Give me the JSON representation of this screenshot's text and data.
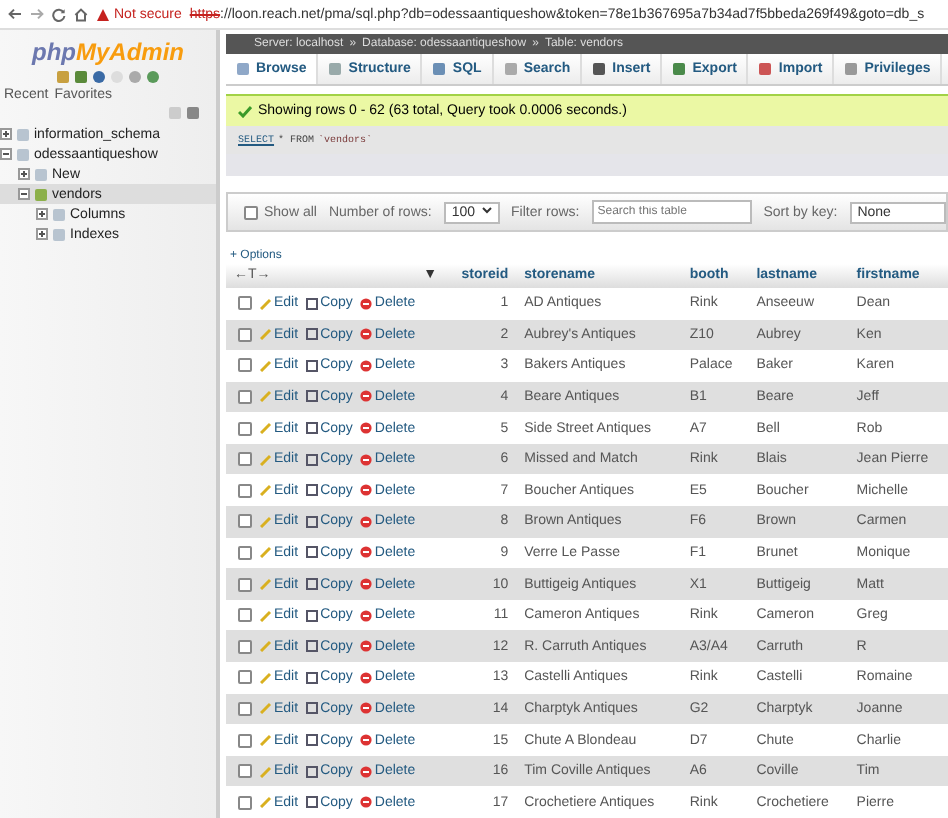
{
  "browser": {
    "security": "Not secure",
    "url_scheme": "https",
    "url_rest": "://loon.reach.net/pma/sql.php?db=odessaantiqueshow&token=78e1b367695a7b34ad7f5bbeda269f49&goto=db_s"
  },
  "sidebar": {
    "logo_left": "php",
    "logo_right": "MyAdmin",
    "links": [
      "Recent",
      "Favorites"
    ],
    "tree": [
      {
        "label": "information_schema",
        "expanded": false,
        "selected": false
      },
      {
        "label": "odessaantiqueshow",
        "expanded": true,
        "selected": false,
        "children": [
          {
            "label": "New",
            "expanded": false,
            "selected": false
          },
          {
            "label": "vendors",
            "expanded": true,
            "selected": true,
            "children": [
              {
                "label": "Columns",
                "expanded": false,
                "selected": false
              },
              {
                "label": "Indexes",
                "expanded": false,
                "selected": false
              }
            ]
          }
        ]
      }
    ]
  },
  "breadcrumb": [
    "Server: localhost",
    "»",
    "Database: odessaantiqueshow",
    "»",
    "Table: vendors"
  ],
  "tabs": [
    {
      "label": "Browse",
      "selected": true
    },
    {
      "label": "Structure",
      "selected": false
    },
    {
      "label": "SQL",
      "selected": false
    },
    {
      "label": "Search",
      "selected": false
    },
    {
      "label": "Insert",
      "selected": false
    },
    {
      "label": "Export",
      "selected": false
    },
    {
      "label": "Import",
      "selected": false
    },
    {
      "label": "Privileges",
      "selected": false
    }
  ],
  "message": "Showing rows 0 - 62 (63 total, Query took 0.0006 seconds.)",
  "query": {
    "keyword1": "SELECT",
    "rest": "* FROM",
    "table": "`vendors`"
  },
  "filter_bar": {
    "show_all": {
      "label": "Show all",
      "checked": false
    },
    "rows_label": "Number of rows:",
    "rows_value": "100",
    "filter_label": "Filter rows:",
    "filter_placeholder": "Search this table",
    "sort_label": "Sort by key:",
    "sort_value": "None"
  },
  "options": "+ Options",
  "table": {
    "resize_handle": "←T→",
    "sort_marker": "▼",
    "columns": [
      "storeid",
      "storename",
      "booth",
      "lastname",
      "firstname"
    ],
    "rows": [
      {
        "checked": false,
        "actions": [
          "Edit",
          "Copy",
          "Delete"
        ],
        "cells": [
          "1",
          "AD Antiques",
          "Rink",
          "Anseeuw",
          "Dean"
        ]
      },
      {
        "checked": false,
        "actions": [
          "Edit",
          "Copy",
          "Delete"
        ],
        "cells": [
          "2",
          "Aubrey's Antiques",
          "Z10",
          "Aubrey",
          "Ken"
        ]
      },
      {
        "checked": false,
        "actions": [
          "Edit",
          "Copy",
          "Delete"
        ],
        "cells": [
          "3",
          "Bakers Antiques",
          "Palace",
          "Baker",
          "Karen"
        ]
      },
      {
        "checked": false,
        "actions": [
          "Edit",
          "Copy",
          "Delete"
        ],
        "cells": [
          "4",
          "Beare  Antiques",
          "B1",
          "Beare",
          "Jeff"
        ]
      },
      {
        "checked": false,
        "actions": [
          "Edit",
          "Copy",
          "Delete"
        ],
        "cells": [
          "5",
          "Side Street Antiques",
          "A7",
          "Bell",
          "Rob"
        ]
      },
      {
        "checked": false,
        "actions": [
          "Edit",
          "Copy",
          "Delete"
        ],
        "cells": [
          "6",
          "Missed and Match",
          "Rink",
          "Blais",
          "Jean Pierre"
        ]
      },
      {
        "checked": false,
        "actions": [
          "Edit",
          "Copy",
          "Delete"
        ],
        "cells": [
          "7",
          "Boucher Antiques",
          "E5",
          "Boucher",
          "Michelle"
        ]
      },
      {
        "checked": false,
        "actions": [
          "Edit",
          "Copy",
          "Delete"
        ],
        "cells": [
          "8",
          "Brown Antiques",
          "F6",
          "Brown",
          "Carmen"
        ]
      },
      {
        "checked": false,
        "actions": [
          "Edit",
          "Copy",
          "Delete"
        ],
        "cells": [
          "9",
          "Verre Le Passe",
          "F1",
          "Brunet",
          "Monique"
        ]
      },
      {
        "checked": false,
        "actions": [
          "Edit",
          "Copy",
          "Delete"
        ],
        "cells": [
          "10",
          "Buttigeig Antiques",
          "X1",
          "Buttigeig",
          "Matt"
        ]
      },
      {
        "checked": false,
        "actions": [
          "Edit",
          "Copy",
          "Delete"
        ],
        "cells": [
          "11",
          "Cameron Antiques",
          "Rink",
          "Cameron",
          "Greg"
        ]
      },
      {
        "checked": false,
        "actions": [
          "Edit",
          "Copy",
          "Delete"
        ],
        "cells": [
          "12",
          "R. Carruth Antiques",
          "A3/A4",
          "Carruth",
          "R"
        ]
      },
      {
        "checked": false,
        "actions": [
          "Edit",
          "Copy",
          "Delete"
        ],
        "cells": [
          "13",
          "Castelli Antiques",
          "Rink",
          "Castelli",
          "Romaine"
        ]
      },
      {
        "checked": false,
        "actions": [
          "Edit",
          "Copy",
          "Delete"
        ],
        "cells": [
          "14",
          "Charptyk Antiques",
          "G2",
          "Charptyk",
          "Joanne"
        ]
      },
      {
        "checked": false,
        "actions": [
          "Edit",
          "Copy",
          "Delete"
        ],
        "cells": [
          "15",
          "Chute A Blondeau",
          "D7",
          "Chute",
          "Charlie"
        ]
      },
      {
        "checked": false,
        "actions": [
          "Edit",
          "Copy",
          "Delete"
        ],
        "cells": [
          "16",
          "Tim Coville Antiques",
          "A6",
          "Coville",
          "Tim"
        ]
      },
      {
        "checked": false,
        "actions": [
          "Edit",
          "Copy",
          "Delete"
        ],
        "cells": [
          "17",
          "Crochetiere Antiques",
          "Rink",
          "Crochetiere",
          "Pierre"
        ]
      }
    ]
  }
}
